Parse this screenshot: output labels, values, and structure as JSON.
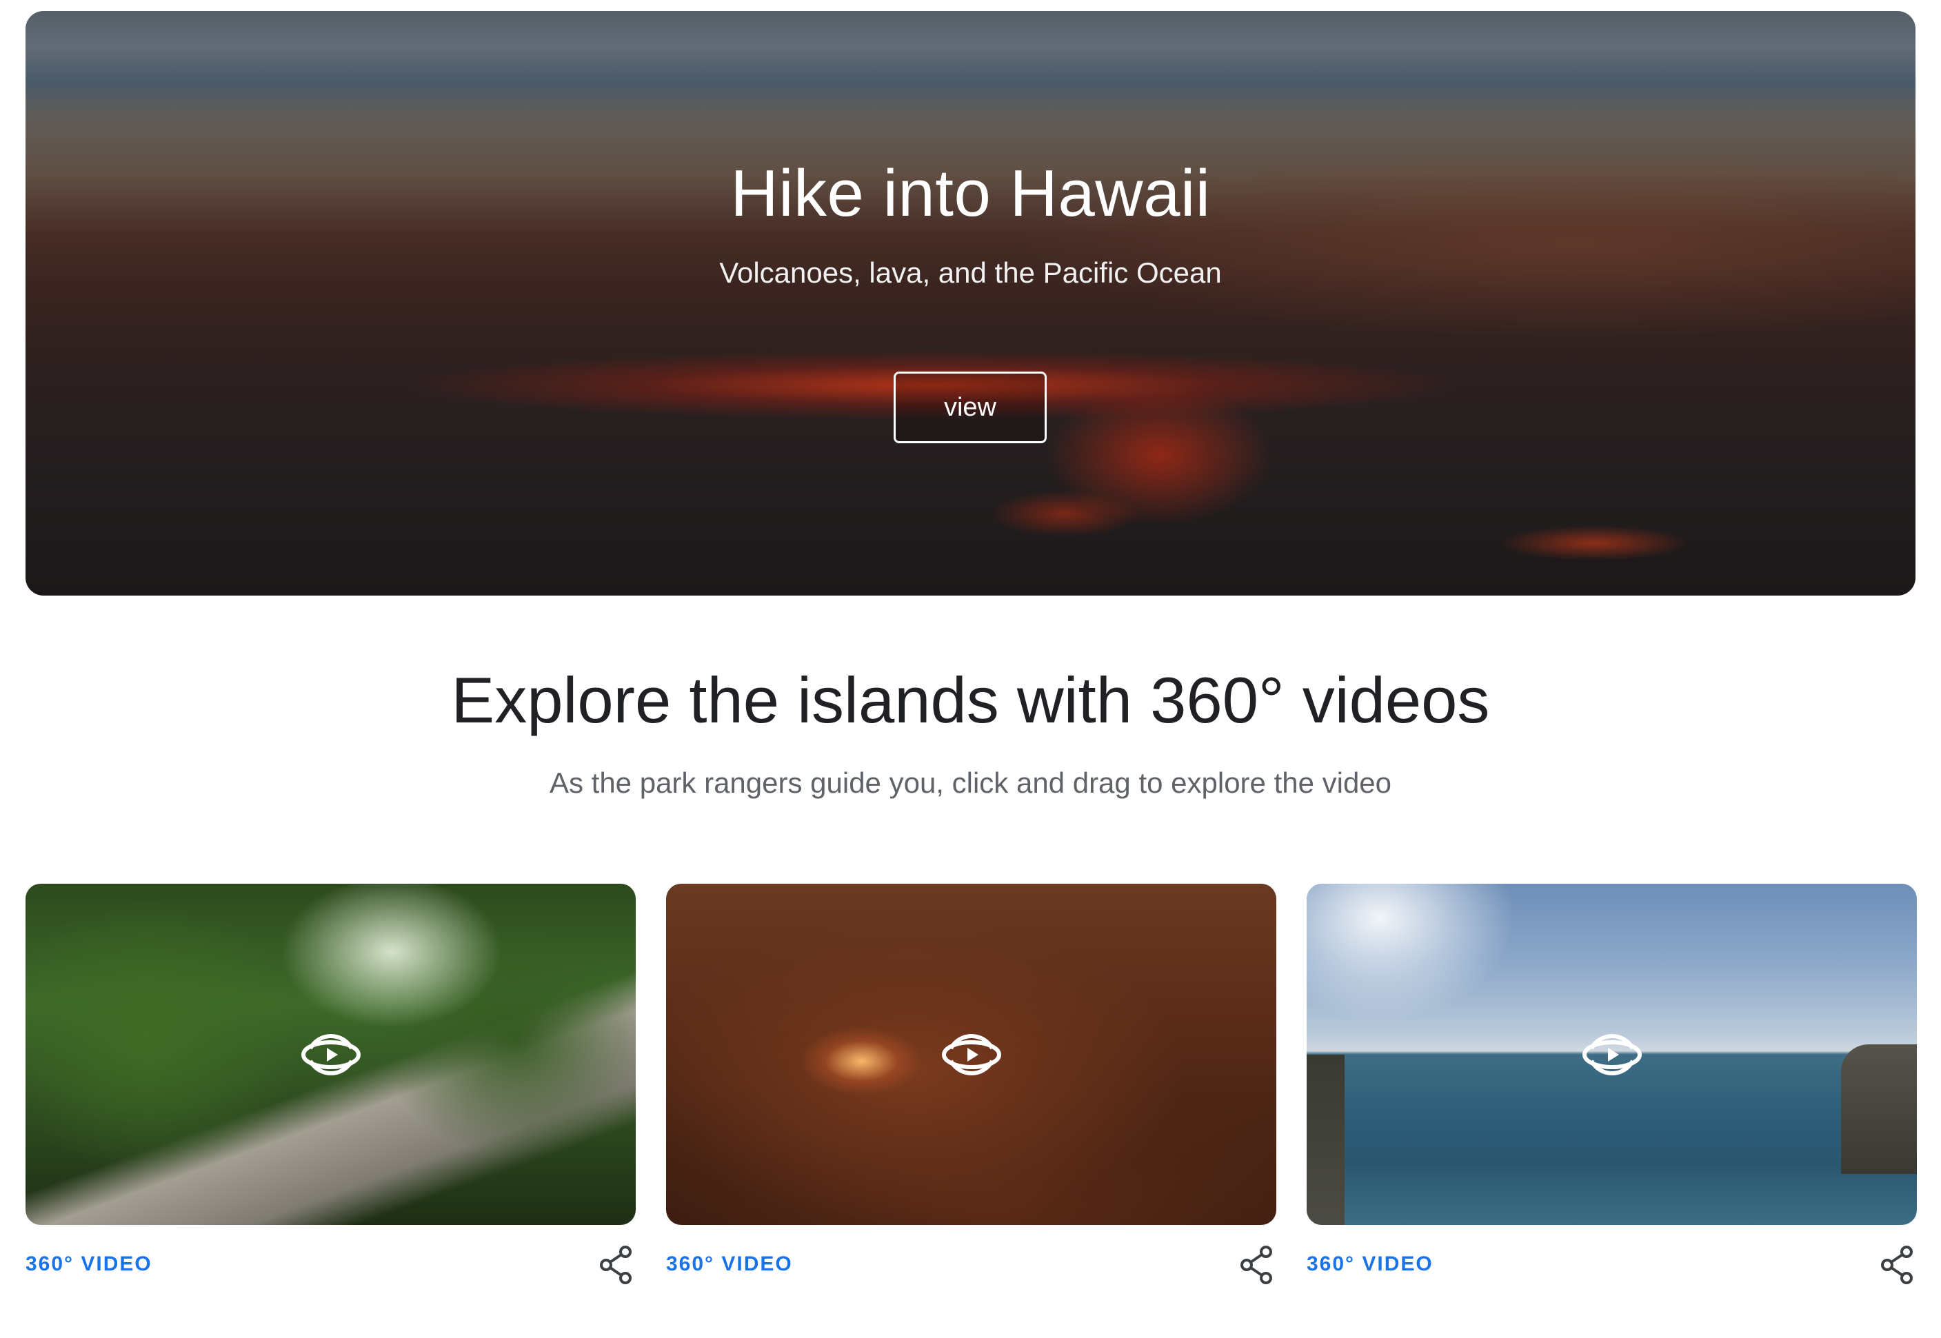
{
  "hero": {
    "title": "Hike into Hawaii",
    "subtitle": "Volcanoes, lava, and the Pacific Ocean",
    "button_label": "view"
  },
  "section": {
    "title": "Explore the islands with 360° videos",
    "subtitle": "As the park rangers guide you, click and drag to explore the video"
  },
  "cards": [
    {
      "label": "360° VIDEO",
      "scene": "rainforest boardwalk",
      "icon": "360-play-icon",
      "share_icon": "share-icon"
    },
    {
      "label": "360° VIDEO",
      "scene": "lava tube",
      "icon": "360-play-icon",
      "share_icon": "share-icon"
    },
    {
      "label": "360° VIDEO",
      "scene": "ocean cliffs",
      "icon": "360-play-icon",
      "share_icon": "share-icon"
    }
  ],
  "colors": {
    "accent": "#1a73e8",
    "heading": "#202124",
    "subtext": "#5f6368"
  }
}
